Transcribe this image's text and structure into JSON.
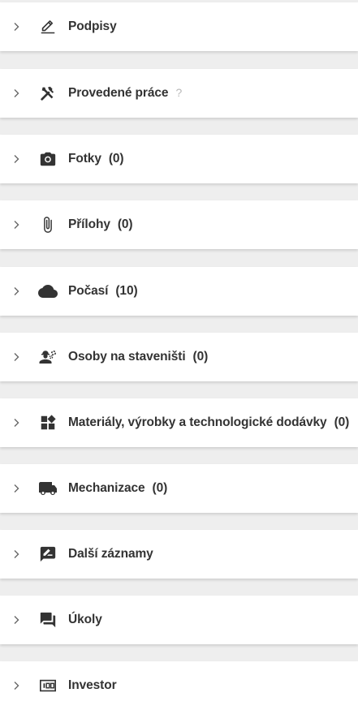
{
  "colors": {
    "background": "#eeeeee",
    "card": "#ffffff",
    "text": "#333333",
    "icon": "#333333",
    "chevron": "#666666",
    "help": "#b8b8b8"
  },
  "sections": [
    {
      "icon": "signature-pen-icon",
      "title": "Podpisy",
      "count": "",
      "help": ""
    },
    {
      "icon": "tools-icon",
      "title": "Provedené práce",
      "count": "",
      "help": "?"
    },
    {
      "icon": "camera-icon",
      "title": "Fotky",
      "count": "(0)",
      "help": ""
    },
    {
      "icon": "paperclip-icon",
      "title": "Přílohy",
      "count": "(0)",
      "help": ""
    },
    {
      "icon": "cloud-icon",
      "title": "Počasí",
      "count": "(10)",
      "help": ""
    },
    {
      "icon": "engineering-person-icon",
      "title": "Osoby na staveništi",
      "count": "(0)",
      "help": ""
    },
    {
      "icon": "widgets-icon",
      "title": "Materiály, výrobky a technologické dodávky",
      "count": "(0)",
      "help": ""
    },
    {
      "icon": "truck-icon",
      "title": "Mechanizace",
      "count": "(0)",
      "help": ""
    },
    {
      "icon": "rate-review-icon",
      "title": "Další záznamy",
      "count": "",
      "help": ""
    },
    {
      "icon": "forum-icon",
      "title": "Úkoly",
      "count": "",
      "help": ""
    },
    {
      "icon": "money-icon",
      "title": "Investor",
      "count": "",
      "help": ""
    }
  ]
}
